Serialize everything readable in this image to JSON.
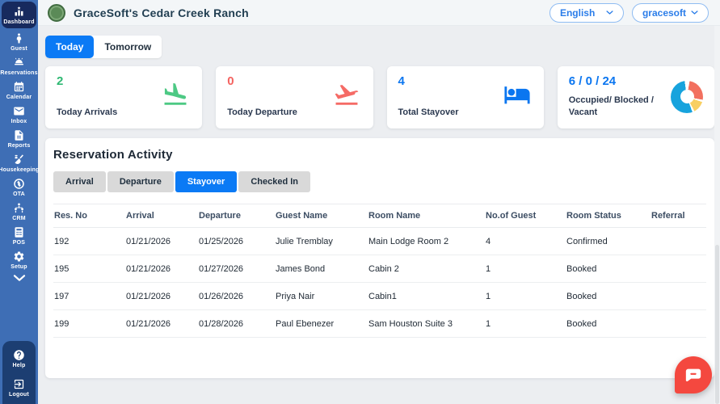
{
  "header": {
    "title": "GraceSoft's Cedar Creek Ranch",
    "language": "English",
    "user": "gracesoft"
  },
  "sidebar": {
    "items": [
      {
        "label": "Dashboard",
        "icon": "dashboard-icon",
        "active": true
      },
      {
        "label": "Guest",
        "icon": "guest-icon"
      },
      {
        "label": "Reservations",
        "icon": "reservations-icon"
      },
      {
        "label": "Calendar",
        "icon": "calendar-icon"
      },
      {
        "label": "Inbox",
        "icon": "inbox-icon"
      },
      {
        "label": "Reports",
        "icon": "reports-icon"
      },
      {
        "label": "Housekeeping",
        "icon": "housekeeping-icon"
      },
      {
        "label": "OTA",
        "icon": "ota-icon"
      },
      {
        "label": "CRM",
        "icon": "crm-icon"
      },
      {
        "label": "POS",
        "icon": "pos-icon"
      },
      {
        "label": "Setup",
        "icon": "setup-icon"
      }
    ],
    "footer_items": [
      {
        "label": "Help",
        "icon": "help-icon"
      },
      {
        "label": "Logout",
        "icon": "logout-icon"
      }
    ]
  },
  "tabs": [
    {
      "label": "Today",
      "active": true
    },
    {
      "label": "Tomorrow",
      "active": false
    }
  ],
  "stats": [
    {
      "value": "2",
      "label": "Today Arrivals",
      "value_color": "#2eb872",
      "icon": "plane-landing-icon",
      "icon_color": "#4dc984"
    },
    {
      "value": "0",
      "label": "Today Departure",
      "value_color": "#f4625f",
      "icon": "plane-takeoff-icon",
      "icon_color": "#f56b66"
    },
    {
      "value": "4",
      "label": "Total Stayover",
      "value_color": "#0b76f0",
      "icon": "bed-icon",
      "icon_color": "#0b76f0"
    },
    {
      "value": "6 / 0 / 24",
      "label": "Occupied/ Blocked / Vacant",
      "value_color": "#0b76f0",
      "icon": "donut-chart-icon",
      "donut_colors": {
        "occupied": "#f2705f",
        "blocked": "#f8cf62",
        "vacant": "#17a3dd"
      }
    }
  ],
  "activity": {
    "title": "Reservation Activity",
    "filters": [
      {
        "label": "Arrival",
        "active": false
      },
      {
        "label": "Departure",
        "active": false
      },
      {
        "label": "Stayover",
        "active": true
      },
      {
        "label": "Checked In",
        "active": false
      }
    ],
    "table": {
      "columns": [
        "Res. No",
        "Arrival",
        "Departure",
        "Guest Name",
        "Room Name",
        "No.of Guest",
        "Room Status",
        "Referral"
      ],
      "rows": [
        [
          "192",
          "01/21/2026",
          "01/25/2026",
          "Julie Tremblay",
          "Main Lodge Room 2",
          "4",
          "Confirmed",
          ""
        ],
        [
          "195",
          "01/21/2026",
          "01/27/2026",
          "James Bond",
          "Cabin 2",
          "1",
          "Booked",
          ""
        ],
        [
          "197",
          "01/21/2026",
          "01/26/2026",
          "Priya Nair",
          "Cabin1",
          "1",
          "Booked",
          ""
        ],
        [
          "199",
          "01/21/2026",
          "01/28/2026",
          "Paul Ebenezer",
          "Sam Houston Suite 3",
          "1",
          "Booked",
          ""
        ]
      ]
    }
  },
  "colors": {
    "sidebar": "#3e6eb5",
    "sidebar_active": "#172a5e",
    "sidebar_footer": "#1c3e72",
    "accent_blue": "#0b7af5",
    "chat_button": "#f4483f"
  }
}
